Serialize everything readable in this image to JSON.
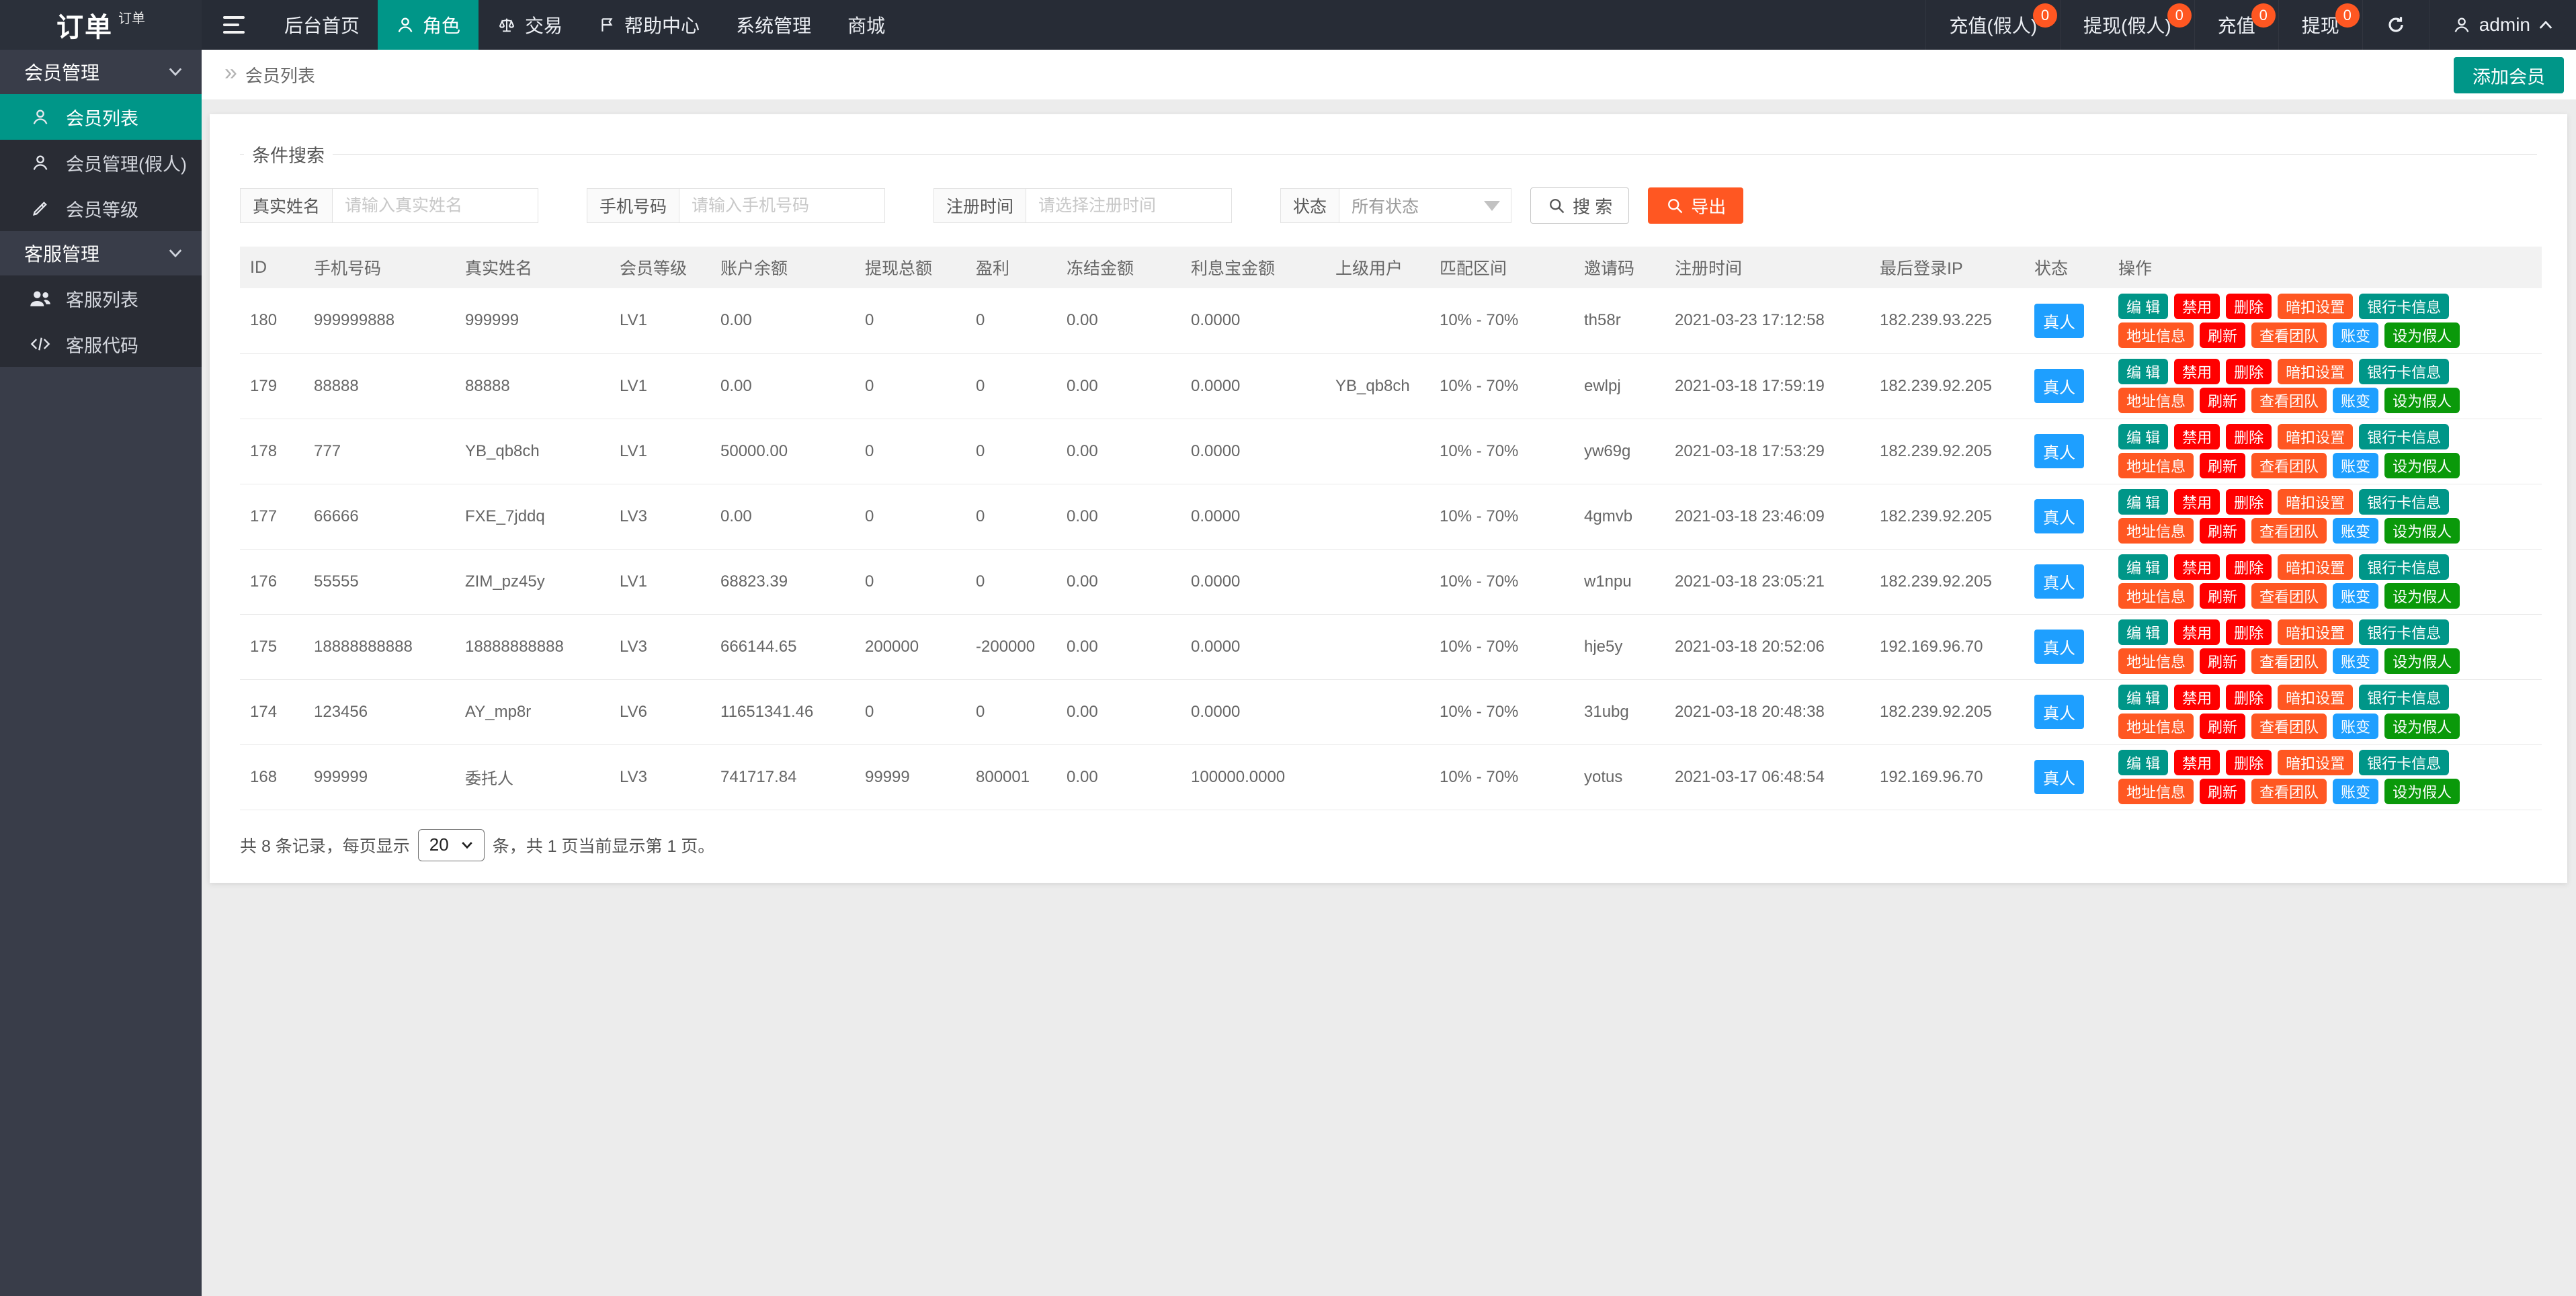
{
  "navbar": {
    "logo_main": "订单",
    "logo_sub": "订单",
    "items": [
      {
        "key": "home",
        "label": "后台首页",
        "icon": null,
        "active": false
      },
      {
        "key": "roles",
        "label": "角色",
        "icon": "user",
        "active": true
      },
      {
        "key": "trade",
        "label": "交易",
        "icon": "scale",
        "active": false
      },
      {
        "key": "help-center",
        "label": "帮助中心",
        "icon": "flag",
        "active": false
      },
      {
        "key": "system",
        "label": "系统管理",
        "icon": null,
        "active": false
      },
      {
        "key": "mall",
        "label": "商城",
        "icon": null,
        "active": false
      }
    ],
    "right_items": [
      {
        "key": "recharge-fake",
        "label": "充值(假人)",
        "badge": "0"
      },
      {
        "key": "withdraw-fake",
        "label": "提现(假人)",
        "badge": "0"
      },
      {
        "key": "recharge",
        "label": "充值",
        "badge": "0"
      },
      {
        "key": "withdraw",
        "label": "提现",
        "badge": "0"
      }
    ],
    "username": "admin"
  },
  "sidebar": {
    "groups": [
      {
        "key": "member-manage",
        "label": "会员管理",
        "items": [
          {
            "key": "member-list",
            "label": "会员列表",
            "icon": "user",
            "active": true
          },
          {
            "key": "member-manage-fake",
            "label": "会员管理(假人)",
            "icon": "user",
            "active": false
          },
          {
            "key": "member-level",
            "label": "会员等级",
            "icon": "pen",
            "active": false
          }
        ]
      },
      {
        "key": "service-manage",
        "label": "客服管理",
        "items": [
          {
            "key": "service-list",
            "label": "客服列表",
            "icon": "users",
            "active": false
          },
          {
            "key": "service-code",
            "label": "客服代码",
            "icon": "code",
            "active": false
          }
        ]
      }
    ]
  },
  "breadcrumb": {
    "title": "会员列表"
  },
  "toolbar": {
    "add_member_label": "添加会员"
  },
  "search": {
    "legend": "条件搜索",
    "real_name": {
      "label": "真实姓名",
      "placeholder": "请输入真实姓名"
    },
    "phone": {
      "label": "手机号码",
      "placeholder": "请输入手机号码"
    },
    "reg_time": {
      "label": "注册时间",
      "placeholder": "请选择注册时间"
    },
    "status": {
      "label": "状态",
      "value": "所有状态"
    },
    "search_label": "搜 索",
    "export_label": "导出"
  },
  "table": {
    "headers": [
      "ID",
      "手机号码",
      "真实姓名",
      "会员等级",
      "账户余额",
      "提现总额",
      "盈利",
      "冻结金额",
      "利息宝金额",
      "上级用户",
      "匹配区间",
      "邀请码",
      "注册时间",
      "最后登录IP",
      "状态",
      "操作"
    ],
    "action_rows": [
      [
        {
          "key": "edit",
          "label": "编 辑",
          "style": "teal"
        },
        {
          "key": "disable",
          "label": "禁用",
          "style": "red"
        },
        {
          "key": "delete",
          "label": "删除",
          "style": "red"
        },
        {
          "key": "hidden-deduct",
          "label": "暗扣设置",
          "style": "orange"
        },
        {
          "key": "bank-card",
          "label": "银行卡信息",
          "style": "teal"
        }
      ],
      [
        {
          "key": "address-info",
          "label": "地址信息",
          "style": "orange"
        },
        {
          "key": "refresh-row",
          "label": "刷新",
          "style": "red"
        },
        {
          "key": "view-team",
          "label": "查看团队",
          "style": "orange"
        },
        {
          "key": "account-change",
          "label": "账变",
          "style": "blue"
        },
        {
          "key": "set-fake",
          "label": "设为假人",
          "style": "green"
        }
      ]
    ],
    "rows": [
      {
        "id": "180",
        "phone": "999999888",
        "name": "999999",
        "level": "LV1",
        "balance": "0.00",
        "withdraw": "0",
        "profit": "0",
        "frozen": "0.00",
        "interest": "0.0000",
        "parent": "",
        "range": "10% - 70%",
        "invite": "th58r",
        "reg_time": "2021-03-23 17:12:58",
        "ip": "182.239.93.225",
        "status": "真人"
      },
      {
        "id": "179",
        "phone": "88888",
        "name": "88888",
        "level": "LV1",
        "balance": "0.00",
        "withdraw": "0",
        "profit": "0",
        "frozen": "0.00",
        "interest": "0.0000",
        "parent": "YB_qb8ch",
        "range": "10% - 70%",
        "invite": "ewlpj",
        "reg_time": "2021-03-18 17:59:19",
        "ip": "182.239.92.205",
        "status": "真人"
      },
      {
        "id": "178",
        "phone": "777",
        "name": "YB_qb8ch",
        "level": "LV1",
        "balance": "50000.00",
        "withdraw": "0",
        "profit": "0",
        "frozen": "0.00",
        "interest": "0.0000",
        "parent": "",
        "range": "10% - 70%",
        "invite": "yw69g",
        "reg_time": "2021-03-18 17:53:29",
        "ip": "182.239.92.205",
        "status": "真人"
      },
      {
        "id": "177",
        "phone": "66666",
        "name": "FXE_7jddq",
        "level": "LV3",
        "balance": "0.00",
        "withdraw": "0",
        "profit": "0",
        "frozen": "0.00",
        "interest": "0.0000",
        "parent": "",
        "range": "10% - 70%",
        "invite": "4gmvb",
        "reg_time": "2021-03-18 23:46:09",
        "ip": "182.239.92.205",
        "status": "真人"
      },
      {
        "id": "176",
        "phone": "55555",
        "name": "ZIM_pz45y",
        "level": "LV1",
        "balance": "68823.39",
        "withdraw": "0",
        "profit": "0",
        "frozen": "0.00",
        "interest": "0.0000",
        "parent": "",
        "range": "10% - 70%",
        "invite": "w1npu",
        "reg_time": "2021-03-18 23:05:21",
        "ip": "182.239.92.205",
        "status": "真人"
      },
      {
        "id": "175",
        "phone": "18888888888",
        "name": "18888888888",
        "level": "LV3",
        "balance": "666144.65",
        "withdraw": "200000",
        "profit": "-200000",
        "frozen": "0.00",
        "interest": "0.0000",
        "parent": "",
        "range": "10% - 70%",
        "invite": "hje5y",
        "reg_time": "2021-03-18 20:52:06",
        "ip": "192.169.96.70",
        "status": "真人"
      },
      {
        "id": "174",
        "phone": "123456",
        "name": "AY_mp8r",
        "level": "LV6",
        "balance": "11651341.46",
        "withdraw": "0",
        "profit": "0",
        "frozen": "0.00",
        "interest": "0.0000",
        "parent": "",
        "range": "10% - 70%",
        "invite": "31ubg",
        "reg_time": "2021-03-18 20:48:38",
        "ip": "182.239.92.205",
        "status": "真人"
      },
      {
        "id": "168",
        "phone": "999999",
        "name": "委托人",
        "level": "LV3",
        "balance": "741717.84",
        "withdraw": "99999",
        "profit": "800001",
        "frozen": "0.00",
        "interest": "100000.0000",
        "parent": "",
        "range": "10% - 70%",
        "invite": "yotus",
        "reg_time": "2021-03-17 06:48:54",
        "ip": "192.169.96.70",
        "status": "真人"
      }
    ]
  },
  "pagination": {
    "prefix": "共 8 条记录，每页显示",
    "page_size": "20",
    "suffix": "条，共 1 页当前显示第 1 页。"
  },
  "colors": {
    "accent_teal": "#009688",
    "danger_red": "#ff0000",
    "warn_orange": "#ff5722",
    "info_blue": "#1e9fff",
    "fake_green": "#0a990a",
    "badge_orange": "#ff5722",
    "navbar_bg": "#272c36",
    "sidebar_bg": "#393d49"
  }
}
